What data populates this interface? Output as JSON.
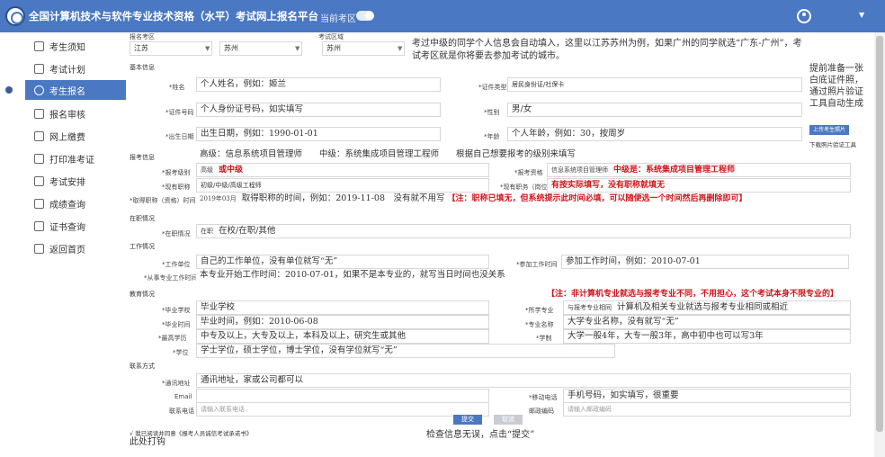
{
  "app": {
    "title": "全国计算机技术与软件专业技术资格（水平）考试网上报名平台",
    "region_label": "当前考区"
  },
  "sidebar": {
    "items": [
      {
        "label": "考生须知"
      },
      {
        "label": "考试计划"
      },
      {
        "label": "考生报名"
      },
      {
        "label": "报名审核"
      },
      {
        "label": "网上缴费"
      },
      {
        "label": "打印准考证"
      },
      {
        "label": "考试安排"
      },
      {
        "label": "成绩查询"
      },
      {
        "label": "证书查询"
      },
      {
        "label": "返回首页"
      }
    ]
  },
  "form": {
    "location": {
      "label1": "报名考区",
      "label2": "考试区域",
      "province": "江苏",
      "city": "苏州",
      "exam_city": "苏州",
      "note": "考过中级的同学个人信息会自动填入，这里以江苏苏州为例，如果广州的同学就选“广东-广州”，考试考区就是你将要去参加考试的城市。"
    },
    "basic_section": "基本信息",
    "name_label": "*姓名",
    "name_value": "个人姓名，例如：姬兰",
    "idtype_label": "*证件类型",
    "idtype_value": "居民身份证/社保卡",
    "idnum_label": "*证件号码",
    "idnum_value": "个人身份证号码，如实填写",
    "sex_label": "*性别",
    "sex_value": "男/女",
    "birth_label": "*出生日期",
    "birth_value": "出生日期，例如：1990-01-01",
    "age_label": "*年龄",
    "age_value": "个人年龄，例如：30，按周岁",
    "photo_note": "提前准备一张白底证件照，通过照片验证工具自动生成",
    "photo_btn": "上传考生照片",
    "photo_link": "下载照片验证工具",
    "exam_section": "报考信息",
    "exam_hint": "高级：信息系统项目管理师　　中级：系统集成项目管理工程师　　根据自己想要报考的级别来填写",
    "level_label": "*报考级别",
    "level_value_small": "高级",
    "level_value": "或中级",
    "subject_label": "*报考资格",
    "subject_value_small": "信息系统项目管理师",
    "subject_value": "中级是：系统集成项目管理工程师",
    "title_label": "*现有职称",
    "title_value": "初级/中级/高级工程师",
    "duty_label": "*现有职务（岗位）",
    "duty_value": "有按实际填写，没有职称就填无",
    "title_time_label": "*取得职称（资格）时间",
    "title_time_small": "2019年03月",
    "title_time_value": "取得职称的时间，例如：2019-11-08　没有就不用写",
    "title_time_red": "【注：职称已填无，但系统提示此时间必填，可以随便选一个时间然后再删除即可】",
    "status_section": "在职情况",
    "status_label": "*在职情况",
    "status_small": "在职",
    "status_value": "在校/在职/其他",
    "work_section": "工作情况",
    "employer_label": "*工作单位",
    "employer_value": "自己的工作单位，没有单位就写“无”",
    "worktime_label": "*参加工作时间",
    "worktime_value": "参加工作时间，例如：2010-07-01",
    "major_time_label": "*从事专业工作时间",
    "major_time_value": "本专业开始工作时间：2010-07-01，如果不是本专业的，就写当日时间也没关系",
    "edu_red": "【注：非计算机专业就选与报考专业不同，不用担心，这个考试本身不限专业的】",
    "edu_section": "教育情况",
    "school_label": "*毕业学校",
    "school_value": "毕业学校",
    "major_rel_label": "*所学专业",
    "major_rel_small": "与报考专业相同",
    "major_rel_value": "计算机及相关专业就选与报考专业相同或相近",
    "gradtime_label": "*毕业时间",
    "gradtime_value": "毕业时间，例如：2010-06-08",
    "majorname_label": "*专业名称",
    "majorname_value": "大学专业名称，没有就写“无”",
    "degree_label": "*最高学历",
    "degree_value": "中专及以上，大专及以上，本科及以上，研究生或其他",
    "years_label": "*学制",
    "years_value": "大学一般4年，大专一般3年，高中初中也可以写3年",
    "xuewei_label": "*学位",
    "xuewei_value": "学士学位，硕士学位，博士学位，没有学位就写“无”",
    "contact_section": "联系方式",
    "addr_label": "*通讯地址",
    "addr_value": "通讯地址，家或公司都可以",
    "email_label": "Email",
    "phone_label": "*移动电话",
    "phone_value": "手机号码，如实填写，很重要",
    "tel_label": "联系电话",
    "tel_placeholder": "请输入联系电话",
    "postcode_label": "邮政编码",
    "postcode_placeholder": "请输入邮政编码",
    "agree_text": "√ 我已阅读并同意《报考人员诚信考试承诺书》",
    "tick_note": "此处打钩",
    "submit_note": "检查信息无误，点击“提交”",
    "submit_label": "提交",
    "cancel_label": "取消"
  },
  "colors": {
    "accent": "#4a78c2",
    "red": "#d0141a"
  }
}
